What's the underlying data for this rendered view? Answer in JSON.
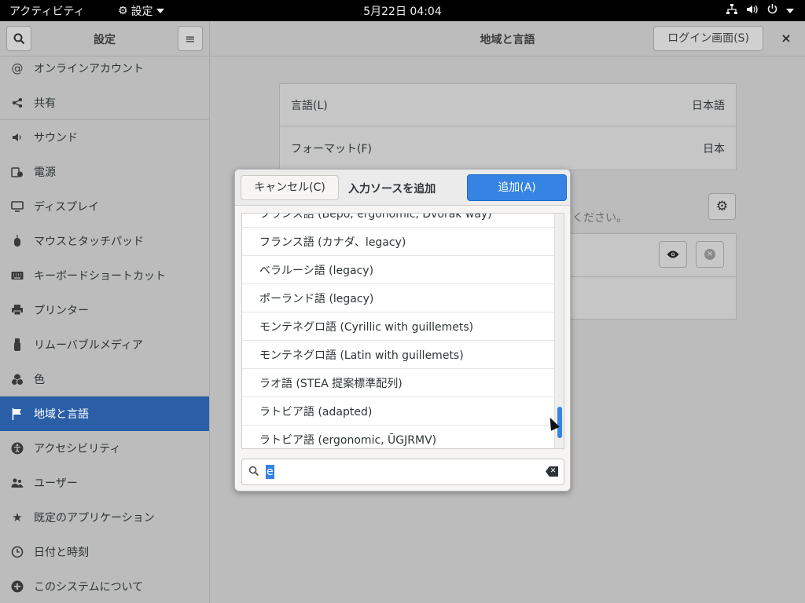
{
  "topbar": {
    "activities": "アクティビティ",
    "app_menu": "設定",
    "clock": "5月22日  04:04",
    "icons": [
      "network-icon",
      "volume-icon",
      "power-icon"
    ]
  },
  "window": {
    "sidebar_title": "設定",
    "title": "地域と言語",
    "login_button": "ログイン画面(S)",
    "close": "×"
  },
  "sidebar": {
    "items": [
      {
        "label": "オンラインアカウント",
        "icon": "at-icon"
      },
      {
        "label": "共有",
        "icon": "share-icon"
      },
      {
        "label": "サウンド",
        "icon": "speaker-icon"
      },
      {
        "label": "電源",
        "icon": "battery-icon"
      },
      {
        "label": "ディスプレイ",
        "icon": "display-icon"
      },
      {
        "label": "マウスとタッチパッド",
        "icon": "mouse-icon"
      },
      {
        "label": "キーボードショートカット",
        "icon": "keyboard-icon"
      },
      {
        "label": "プリンター",
        "icon": "printer-icon"
      },
      {
        "label": "リムーバブルメディア",
        "icon": "usb-icon"
      },
      {
        "label": "色",
        "icon": "color-icon"
      },
      {
        "label": "地域と言語",
        "icon": "flag-icon",
        "active": true
      },
      {
        "label": "アクセシビリティ",
        "icon": "accessibility-icon"
      },
      {
        "label": "ユーザー",
        "icon": "users-icon"
      },
      {
        "label": "既定のアプリケーション",
        "icon": "star-icon"
      },
      {
        "label": "日付と時刻",
        "icon": "clock-icon"
      },
      {
        "label": "このシステムについて",
        "icon": "plus-icon"
      }
    ]
  },
  "main": {
    "language_label": "言語(L)",
    "language_value": "日本語",
    "format_label": "フォーマット(F)",
    "format_value": "日本",
    "hint": "ください。"
  },
  "dialog": {
    "cancel": "キャンセル(C)",
    "title": "入力ソースを追加",
    "add": "追加(A)",
    "items": [
      "フランス語 (Bépo, ergonomic, Dvorak way)",
      "フランス語 (カナダ、legacy)",
      "ベラルーシ語 (legacy)",
      "ポーランド語 (legacy)",
      "モンテネグロ語 (Cyrillic with guillemets)",
      "モンテネグロ語 (Latin with guillemets)",
      "ラオ語 (STEA 提案標準配列)",
      "ラトビア語 (adapted)",
      "ラトビア語 (ergonomic, ŪGJRMV)"
    ],
    "search_value": "e"
  },
  "colors": {
    "accent": "#3584e4",
    "sidebar_active": "#2a5fa8",
    "dimmed_bg": "#bcbcbc"
  }
}
